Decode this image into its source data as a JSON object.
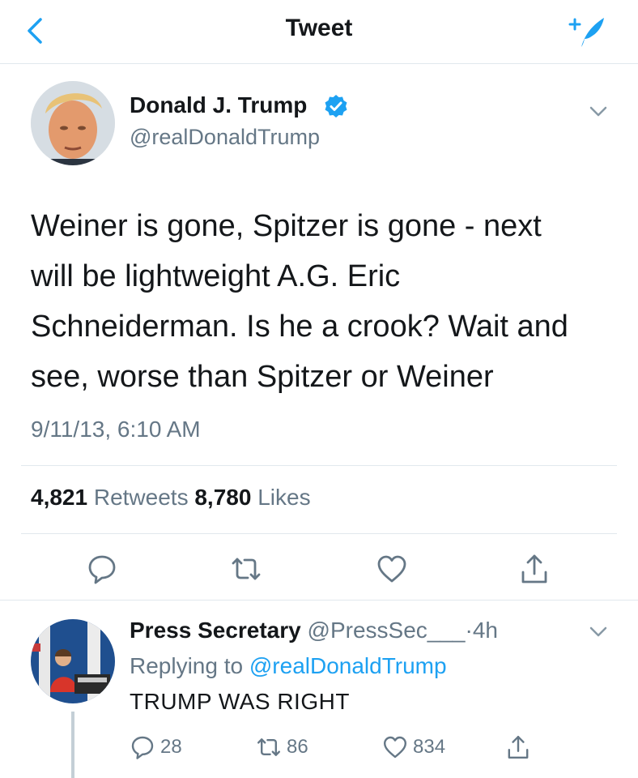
{
  "header": {
    "title": "Tweet",
    "back_icon": "chevron-left-icon",
    "compose_icon": "compose-tweet-icon",
    "accent_color": "#1da1f2"
  },
  "tweet": {
    "author_name": "Donald J. Trump",
    "verified": true,
    "author_handle": "@realDonaldTrump",
    "text_lines": [
      "Weiner is gone, Spitzer is gone - next",
      "will be lightweight A.G. Eric",
      "Schneiderman. Is he a crook? Wait and",
      "see, worse than Spitzer or Weiner"
    ],
    "timestamp": "9/11/13, 6:10 AM",
    "retweet_count": "4,821",
    "retweet_label": "Retweets",
    "like_count": "8,780",
    "like_label": "Likes",
    "actions": [
      "reply-icon",
      "retweet-icon",
      "like-icon",
      "share-icon"
    ]
  },
  "reply": {
    "author_name": "Press Secretary",
    "author_handle": "@PressSec___",
    "separator": "·",
    "age": "4h",
    "replying_prefix": "Replying to",
    "replying_to": "@realDonaldTrump",
    "text": "TRUMP WAS RIGHT",
    "reply_count": "28",
    "retweet_count": "86",
    "like_count": "834"
  }
}
